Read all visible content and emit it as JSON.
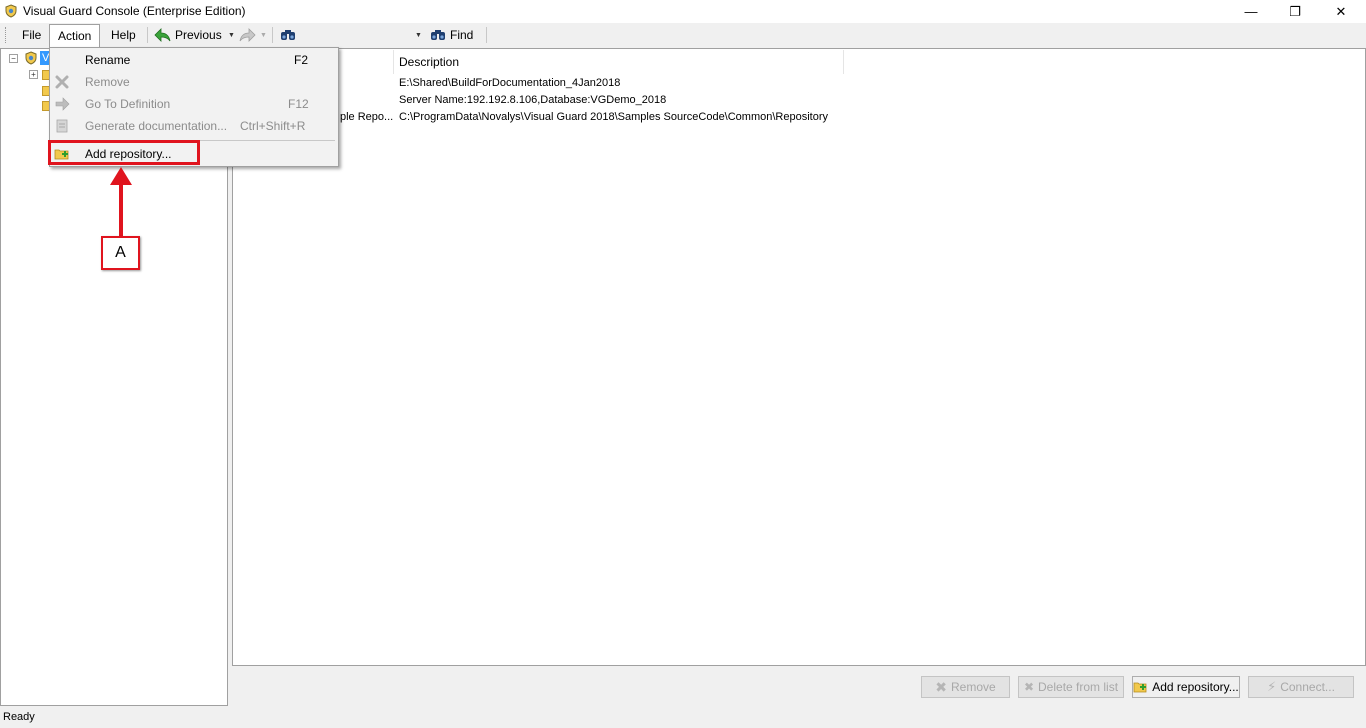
{
  "window": {
    "title": "Visual Guard Console (Enterprise Edition)",
    "minimize_glyph": "—",
    "restore_glyph": "❐",
    "close_glyph": "✕"
  },
  "menubar": {
    "file": "File",
    "action": "Action",
    "help": "Help"
  },
  "toolbar": {
    "previous": "Previous",
    "find": "Find"
  },
  "tree": {
    "root_label_partial": "V"
  },
  "list": {
    "columns": [
      "Description"
    ],
    "rows": [
      {
        "name_partial": "",
        "description": "E:\\Shared\\BuildForDocumentation_4Jan2018"
      },
      {
        "name_partial": "",
        "description": "Server Name:192.192.8.106,Database:VGDemo_2018"
      },
      {
        "name_partial": "ple Repo...",
        "description": "C:\\ProgramData\\Novalys\\Visual Guard 2018\\Samples SourceCode\\Common\\Repository"
      }
    ]
  },
  "action_menu": {
    "items": [
      {
        "label": "Rename",
        "shortcut": "F2",
        "enabled": true,
        "icon": "none"
      },
      {
        "label": "Remove",
        "shortcut": "",
        "enabled": false,
        "icon": "x-icon"
      },
      {
        "label": "Go To Definition",
        "shortcut": "F12",
        "enabled": false,
        "icon": "arrow-right-icon"
      },
      {
        "label": "Generate documentation...",
        "shortcut": "Ctrl+Shift+R",
        "enabled": false,
        "icon": "document-icon"
      },
      {
        "label": "Add repository...",
        "shortcut": "",
        "enabled": true,
        "icon": "folder-add-icon"
      }
    ]
  },
  "bottom_buttons": {
    "remove": "Remove",
    "delete_from_list": "Delete from list",
    "add_repository": "Add repository...",
    "connect": "Connect..."
  },
  "status": {
    "text": "Ready"
  },
  "annotation": {
    "callout_label": "A",
    "color": "#e0141e"
  }
}
